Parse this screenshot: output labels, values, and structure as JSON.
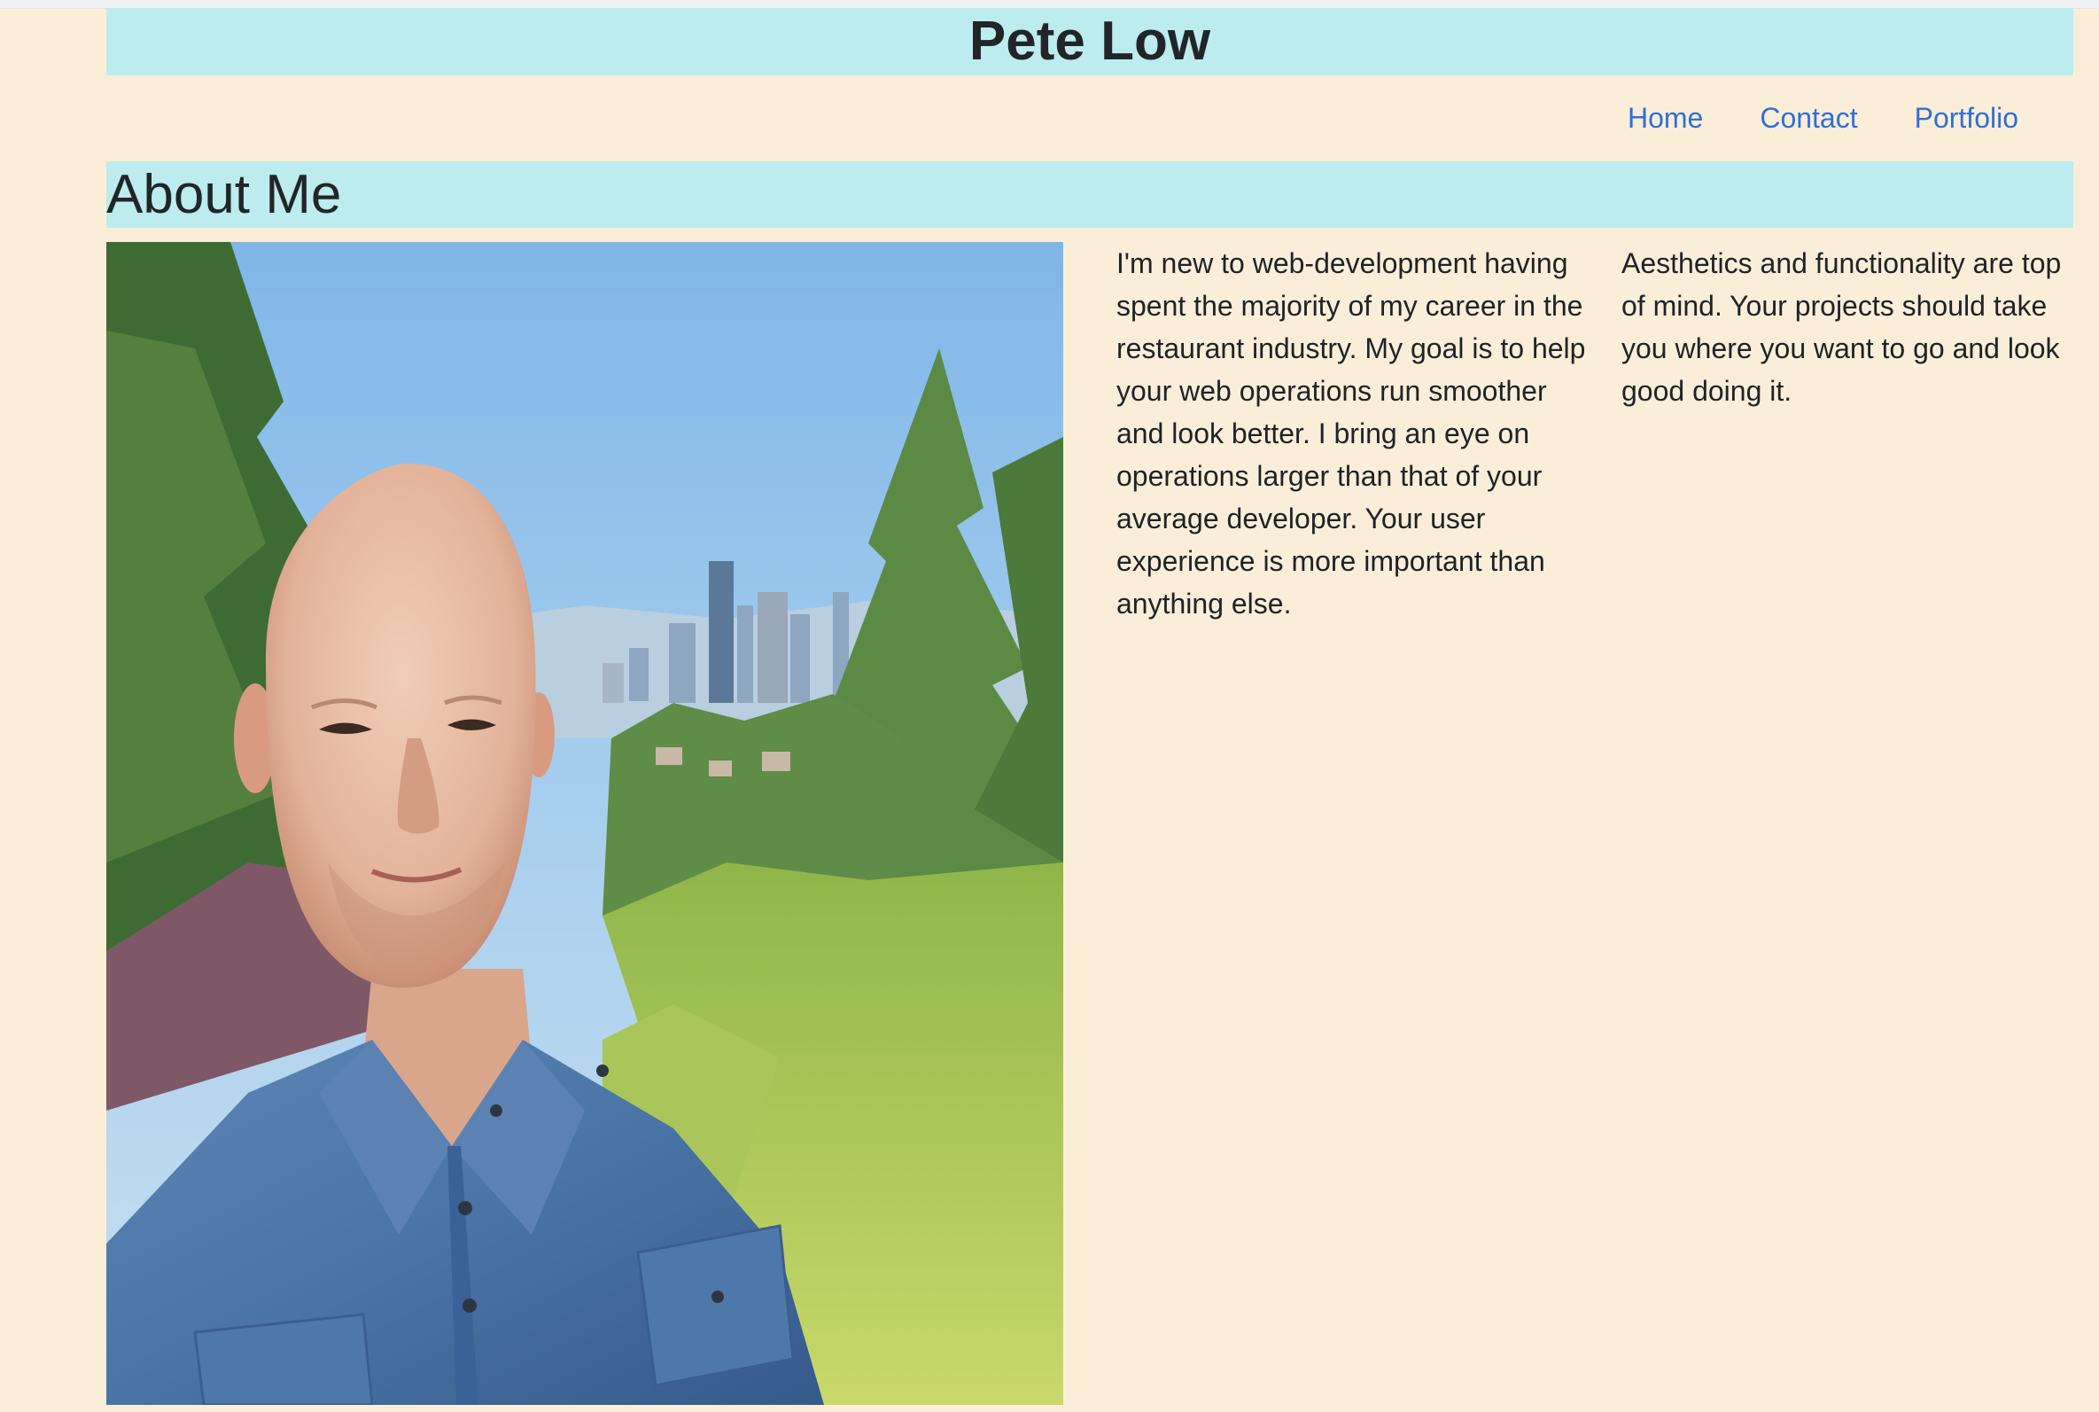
{
  "header": {
    "title": "Pete Low"
  },
  "nav": {
    "items": [
      {
        "label": "Home"
      },
      {
        "label": "Contact"
      },
      {
        "label": "Portfolio"
      }
    ]
  },
  "section": {
    "title": "About Me"
  },
  "about": {
    "paragraph_1": "I'm new to web-development having spent the majority of my career in the restaurant industry. My goal is to help your web operations run smoother and look better. I bring an eye on operations larger than that of your average developer. Your user experience is more important than anything else.",
    "paragraph_2": "Aesthetics and functionality are top of mind. Your projects should take you where you want to go and look good doing it."
  },
  "colors": {
    "background": "#fbeed8",
    "header_bar": "#bdecee",
    "link": "#2f6fd6",
    "text": "#212529"
  },
  "photo": {
    "icon": "portrait-photo"
  }
}
